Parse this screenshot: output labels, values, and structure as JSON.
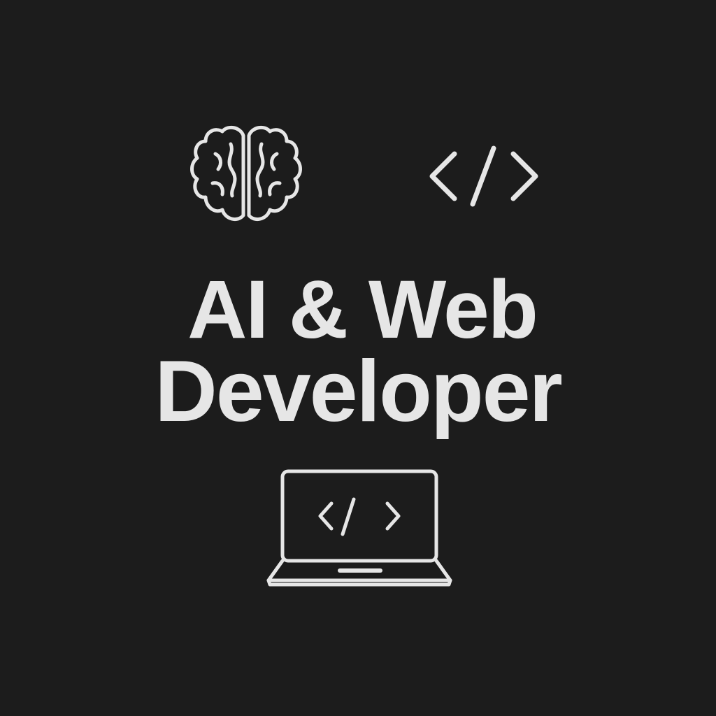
{
  "headline": {
    "line1": "AI & Web",
    "line2": "Developer"
  },
  "icons": {
    "top_left": "brain-icon",
    "top_right": "code-brackets-icon",
    "bottom": "laptop-code-icon"
  },
  "colors": {
    "background": "#1c1c1c",
    "foreground": "#e6e6e6"
  }
}
